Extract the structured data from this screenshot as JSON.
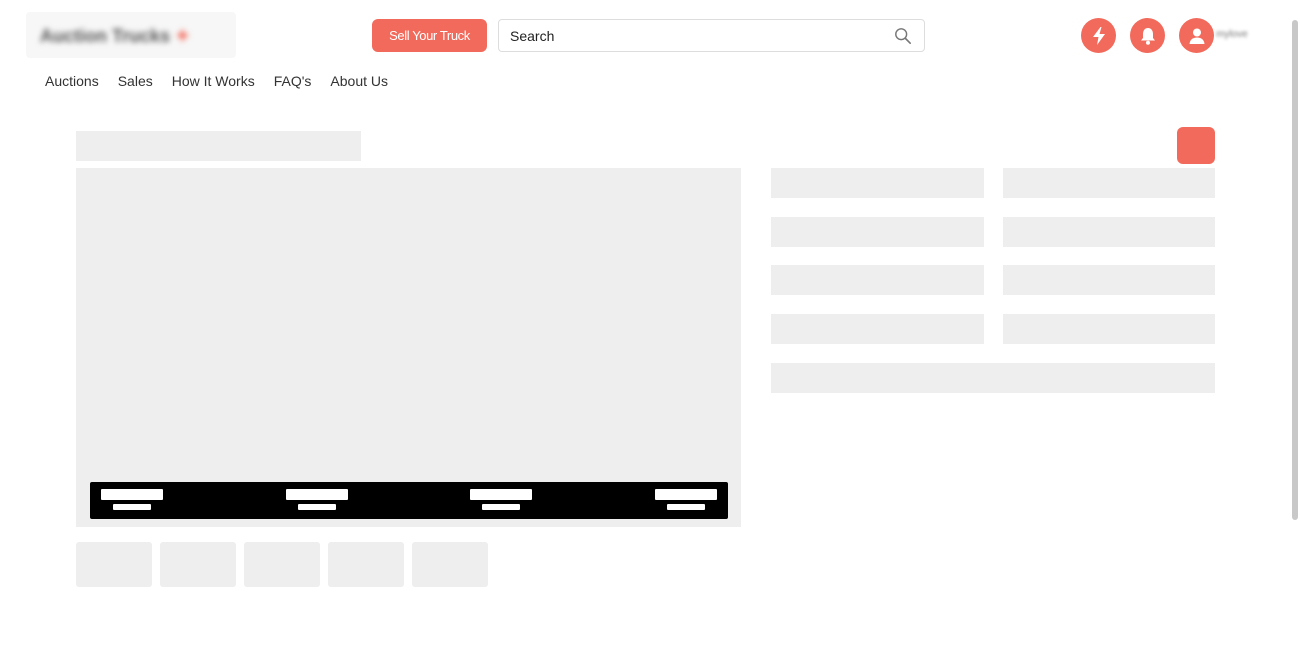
{
  "header": {
    "logo_text": "Auction Trucks",
    "sell_button_label": "Sell Your Truck",
    "search": {
      "placeholder": "Search",
      "value": ""
    },
    "icons": [
      "lightning-icon",
      "bell-icon",
      "user-icon"
    ],
    "user_name": "mylove"
  },
  "nav": {
    "items": [
      {
        "label": "Auctions"
      },
      {
        "label": "Sales"
      },
      {
        "label": "How It Works"
      },
      {
        "label": "FAQ's"
      },
      {
        "label": "About Us"
      }
    ]
  },
  "colors": {
    "accent": "#f26a5b",
    "skeleton": "#eeeeee",
    "info_bar": "#000000"
  }
}
